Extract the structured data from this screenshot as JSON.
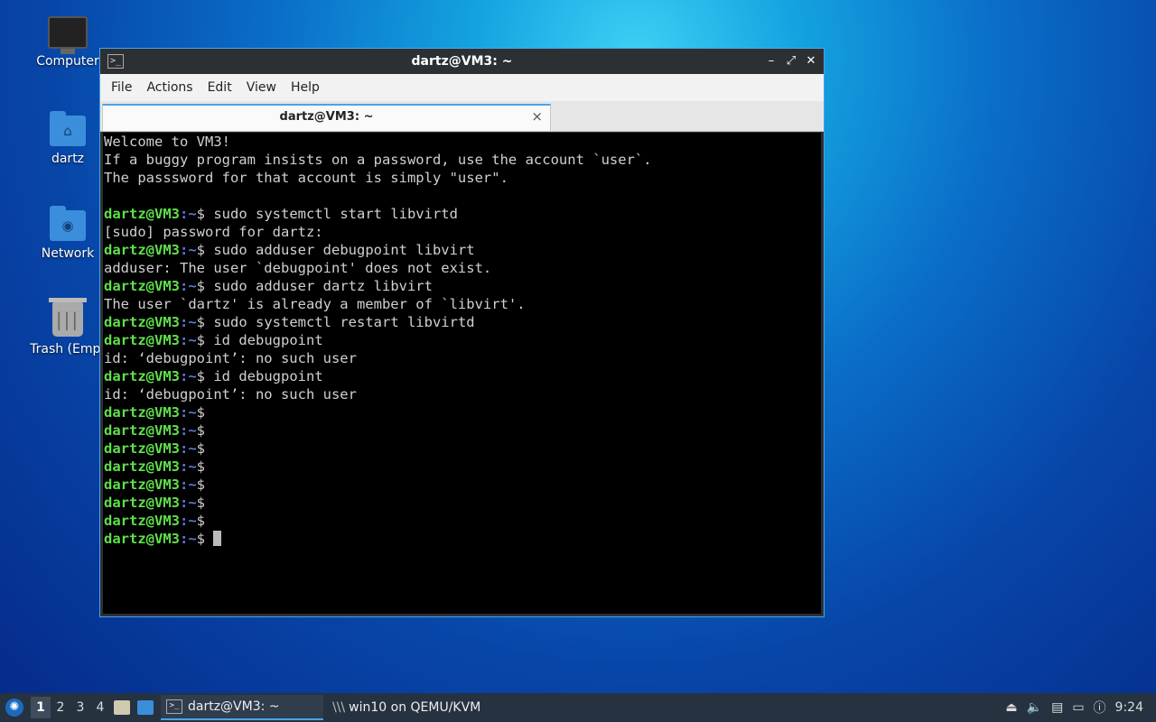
{
  "desktop": {
    "icons": [
      {
        "label": "Computer",
        "icon": "computer-icon"
      },
      {
        "label": "dartz",
        "icon": "home-folder-icon"
      },
      {
        "label": "Network",
        "icon": "network-folder-icon"
      },
      {
        "label": "Trash (Empt",
        "icon": "trash-icon"
      }
    ]
  },
  "window": {
    "title": "dartz@VM3: ~",
    "menu": [
      "File",
      "Actions",
      "Edit",
      "View",
      "Help"
    ],
    "tab_label": "dartz@VM3: ~",
    "tab_close": "×",
    "controls": {
      "minimize": "–",
      "maximize": "⤢",
      "close": "✕"
    }
  },
  "terminal": {
    "prompt_user": "dartz@VM3",
    "prompt_path": ":~",
    "prompt_sym": "$",
    "lines": [
      {
        "type": "out",
        "text": "Welcome to VM3!"
      },
      {
        "type": "out",
        "text": "If a buggy program insists on a password, use the account `user`."
      },
      {
        "type": "out",
        "text": "The passsword for that account is simply \"user\"."
      },
      {
        "type": "out",
        "text": ""
      },
      {
        "type": "cmd",
        "text": " sudo systemctl start libvirtd"
      },
      {
        "type": "out",
        "text": "[sudo] password for dartz:"
      },
      {
        "type": "cmd",
        "text": " sudo adduser debugpoint libvirt"
      },
      {
        "type": "out",
        "text": "adduser: The user `debugpoint' does not exist."
      },
      {
        "type": "cmd",
        "text": " sudo adduser dartz libvirt"
      },
      {
        "type": "out",
        "text": "The user `dartz' is already a member of `libvirt'."
      },
      {
        "type": "cmd",
        "text": " sudo systemctl restart libvirtd"
      },
      {
        "type": "cmd",
        "text": " id debugpoint"
      },
      {
        "type": "out",
        "text": "id: ‘debugpoint’: no such user"
      },
      {
        "type": "cmd",
        "text": " id debugpoint"
      },
      {
        "type": "out",
        "text": "id: ‘debugpoint’: no such user"
      },
      {
        "type": "cmd",
        "text": ""
      },
      {
        "type": "cmd",
        "text": ""
      },
      {
        "type": "cmd",
        "text": ""
      },
      {
        "type": "cmd",
        "text": ""
      },
      {
        "type": "cmd",
        "text": ""
      },
      {
        "type": "cmd",
        "text": ""
      },
      {
        "type": "cmd",
        "text": ""
      },
      {
        "type": "cursor",
        "text": " "
      }
    ]
  },
  "taskbar": {
    "workspaces": [
      "1",
      "2",
      "3",
      "4"
    ],
    "active_workspace": "1",
    "tasks": [
      {
        "label": "dartz@VM3: ~",
        "active": true
      },
      {
        "label": "win10 on QEMU/KVM",
        "active": false
      }
    ],
    "clock": "9:24"
  }
}
